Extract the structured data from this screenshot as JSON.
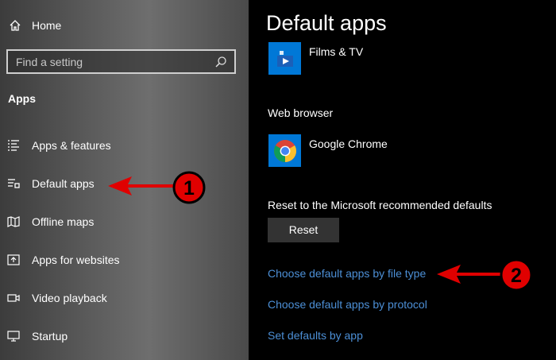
{
  "sidebar": {
    "home_label": "Home",
    "search_placeholder": "Find a setting",
    "section_title": "Apps",
    "items": [
      {
        "label": "Apps & features",
        "icon": "list-icon"
      },
      {
        "label": "Default apps",
        "icon": "default-apps-icon"
      },
      {
        "label": "Offline maps",
        "icon": "map-icon"
      },
      {
        "label": "Apps for websites",
        "icon": "web-app-icon"
      },
      {
        "label": "Video playback",
        "icon": "video-icon"
      },
      {
        "label": "Startup",
        "icon": "startup-icon"
      }
    ]
  },
  "main": {
    "title": "Default apps",
    "video_player": {
      "app_name": "Films & TV",
      "icon": "films-tv-icon",
      "tile_color": "#0078d7"
    },
    "web_browser_label": "Web browser",
    "web_browser": {
      "app_name": "Google Chrome",
      "icon": "chrome-icon",
      "tile_color": "#0078d7"
    },
    "reset_label": "Reset to the Microsoft recommended defaults",
    "reset_button": "Reset",
    "links": [
      "Choose default apps by file type",
      "Choose default apps by protocol",
      "Set defaults by app"
    ]
  },
  "annotations": [
    {
      "number": "1",
      "color": "#e00000"
    },
    {
      "number": "2",
      "color": "#e00000"
    }
  ],
  "colors": {
    "accent_link": "#4c8fd6",
    "tile_blue": "#0078d7",
    "button_bg": "#333333"
  }
}
